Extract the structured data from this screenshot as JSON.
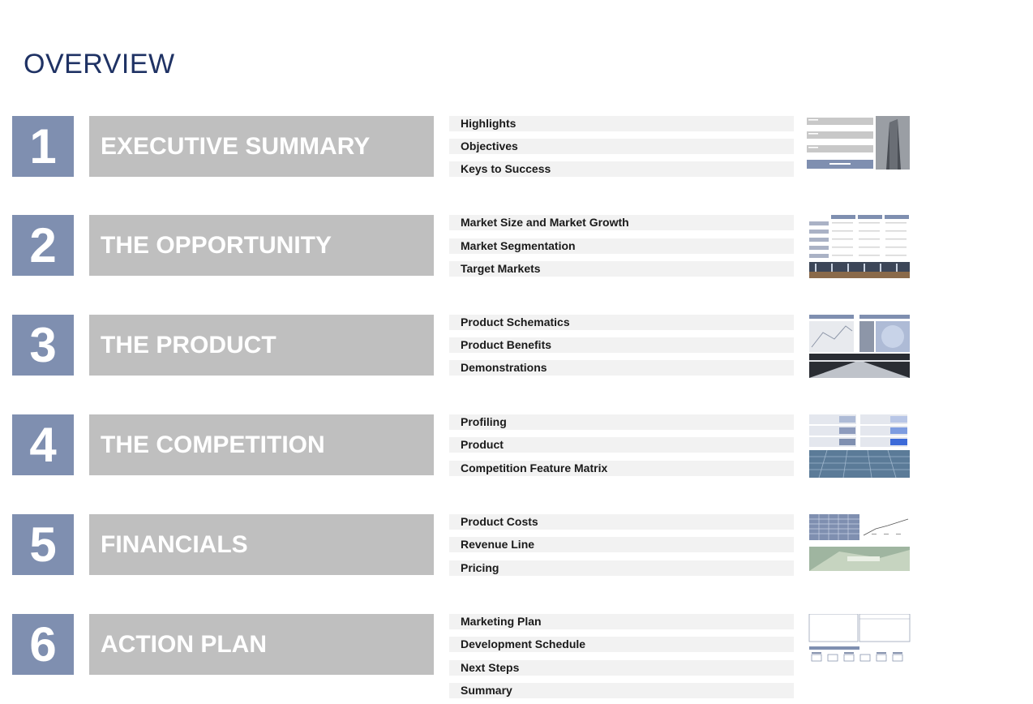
{
  "page": {
    "title": "OVERVIEW"
  },
  "sections": [
    {
      "number": "1",
      "heading": "EXECUTIVE SUMMARY",
      "items": [
        "Highlights",
        "Objectives",
        "Keys to Success"
      ],
      "thumbnail_icon": "executive-summary-slide-thumbnail"
    },
    {
      "number": "2",
      "heading": "THE OPPORTUNITY",
      "items": [
        "Market Size and Market Growth",
        "Market Segmentation",
        "Target Markets"
      ],
      "thumbnail_icon": "opportunity-slide-thumbnail"
    },
    {
      "number": "3",
      "heading": "THE PRODUCT",
      "items": [
        "Product Schematics",
        "Product Benefits",
        "Demonstrations"
      ],
      "thumbnail_icon": "product-slide-thumbnail"
    },
    {
      "number": "4",
      "heading": "THE COMPETITION",
      "items": [
        "Profiling",
        "Product",
        "Competition Feature Matrix"
      ],
      "thumbnail_icon": "competition-slide-thumbnail"
    },
    {
      "number": "5",
      "heading": "FINANCIALS",
      "items": [
        "Product Costs",
        "Revenue Line",
        "Pricing"
      ],
      "thumbnail_icon": "financials-slide-thumbnail"
    },
    {
      "number": "6",
      "heading": "ACTION PLAN",
      "items": [
        "Marketing Plan",
        "Development Schedule",
        "Next Steps",
        "Summary"
      ],
      "thumbnail_icon": "action-plan-slide-thumbnail"
    }
  ],
  "colors": {
    "title": "#1f3264",
    "number_box": "#7f8fb0",
    "band": "#bfbfbf",
    "item_bg": "#f2f2f2"
  }
}
